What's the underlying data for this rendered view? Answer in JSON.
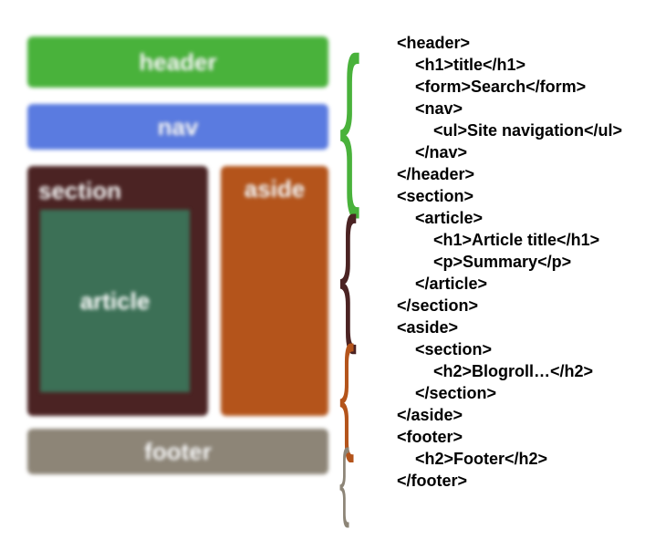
{
  "layout": {
    "header": "header",
    "nav": "nav",
    "section": "section",
    "article": "article",
    "aside": "aside",
    "footer": "footer"
  },
  "code": {
    "lines": [
      "<header>",
      "    <h1>title</h1>",
      "    <form>Search</form>",
      "    <nav>",
      "        <ul>Site navigation</ul>",
      "    </nav>",
      "</header>",
      "<section>",
      "    <article>",
      "        <h1>Article title</h1>",
      "        <p>Summary</p>",
      "    </article>",
      "</section>",
      "<aside>",
      "    <section>",
      "        <h2>Blogroll…</h2>",
      "    </section>",
      "</aside>",
      "<footer>",
      "    <h2>Footer</h2>",
      "</footer>"
    ]
  }
}
